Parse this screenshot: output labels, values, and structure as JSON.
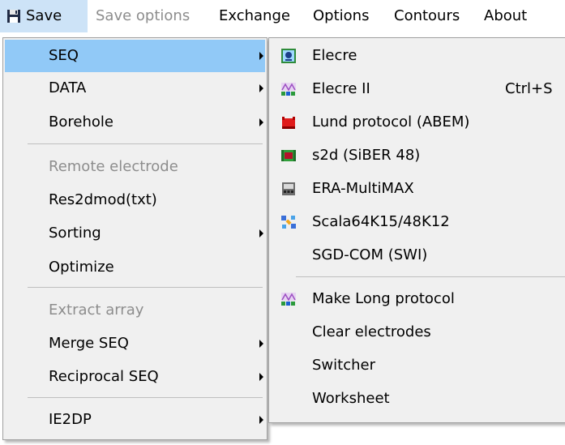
{
  "menubar": {
    "items": [
      "Save",
      "Save options",
      "Exchange",
      "Options",
      "Contours",
      "About"
    ]
  },
  "main_menu": {
    "items": [
      "SEQ",
      "DATA",
      "Borehole",
      "Remote electrode",
      "Res2dmod(txt)",
      "Sorting",
      "Optimize",
      "Extract array",
      "Merge SEQ",
      "Reciprocal SEQ",
      "IE2DP"
    ]
  },
  "sub_menu": {
    "items": [
      "Elecre",
      "Elecre II",
      "Lund protocol (ABEM)",
      "s2d (SiBER 48)",
      "ERA-MultiMAX",
      "Scala64K15/48K12",
      "SGD-COM (SWI)",
      "Make Long protocol",
      "Clear electrodes",
      "Switcher",
      "Worksheet"
    ],
    "shortcut": "Ctrl+S"
  },
  "colors": {
    "menu_bg": "#f0f0f0",
    "highlight": "#91c9f7",
    "menubar_selected": "#cde3f7",
    "disabled_text": "#8d8d8d"
  },
  "icons": {
    "save": "floppy-disk-icon",
    "elecre": "electrode-grid-icon",
    "elecre2": "electrode-pattern-icon",
    "lund": "red-device-icon",
    "s2d": "siber-board-icon",
    "era": "era-meter-icon",
    "scala": "satellite-icon",
    "make_long": "long-protocol-icon"
  }
}
